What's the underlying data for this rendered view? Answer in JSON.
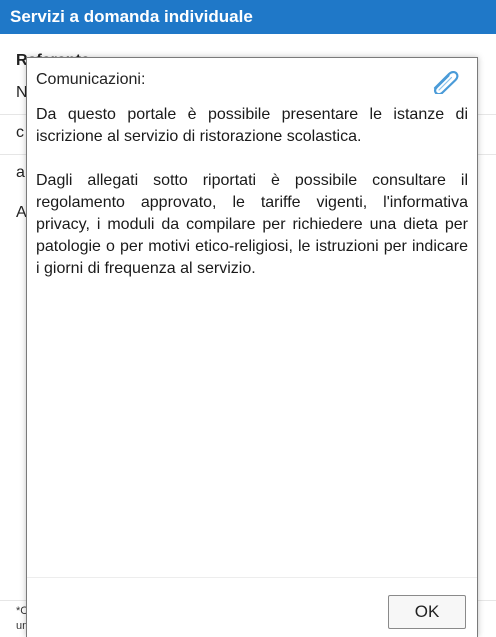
{
  "header": {
    "title": "Servizi a domanda individuale"
  },
  "background": {
    "heading": "Referente",
    "row_letters": [
      "N",
      "c",
      "a",
      "A"
    ],
    "footnote_start": "*C",
    "footnote_second": "un"
  },
  "dialog": {
    "title": "Comunicazioni:",
    "icon": "paperclip-icon",
    "paragraphs": [
      "Da questo portale è possibile presentare le istanze di iscrizione al servizio di ristorazione scolastica.",
      "Dagli allegati sotto riportati è possibile consultare il regolamento approvato, le tariffe vigenti, l'informativa privacy, i moduli da compilare per richiedere una dieta per patologie o per motivi etico-religiosi, le istruzioni per indicare i giorni di frequenza al servizio."
    ],
    "ok_label": "OK"
  },
  "colors": {
    "header_bg": "#1f78c8",
    "header_text": "#ffffff",
    "icon_blue": "#4a9bd8"
  }
}
